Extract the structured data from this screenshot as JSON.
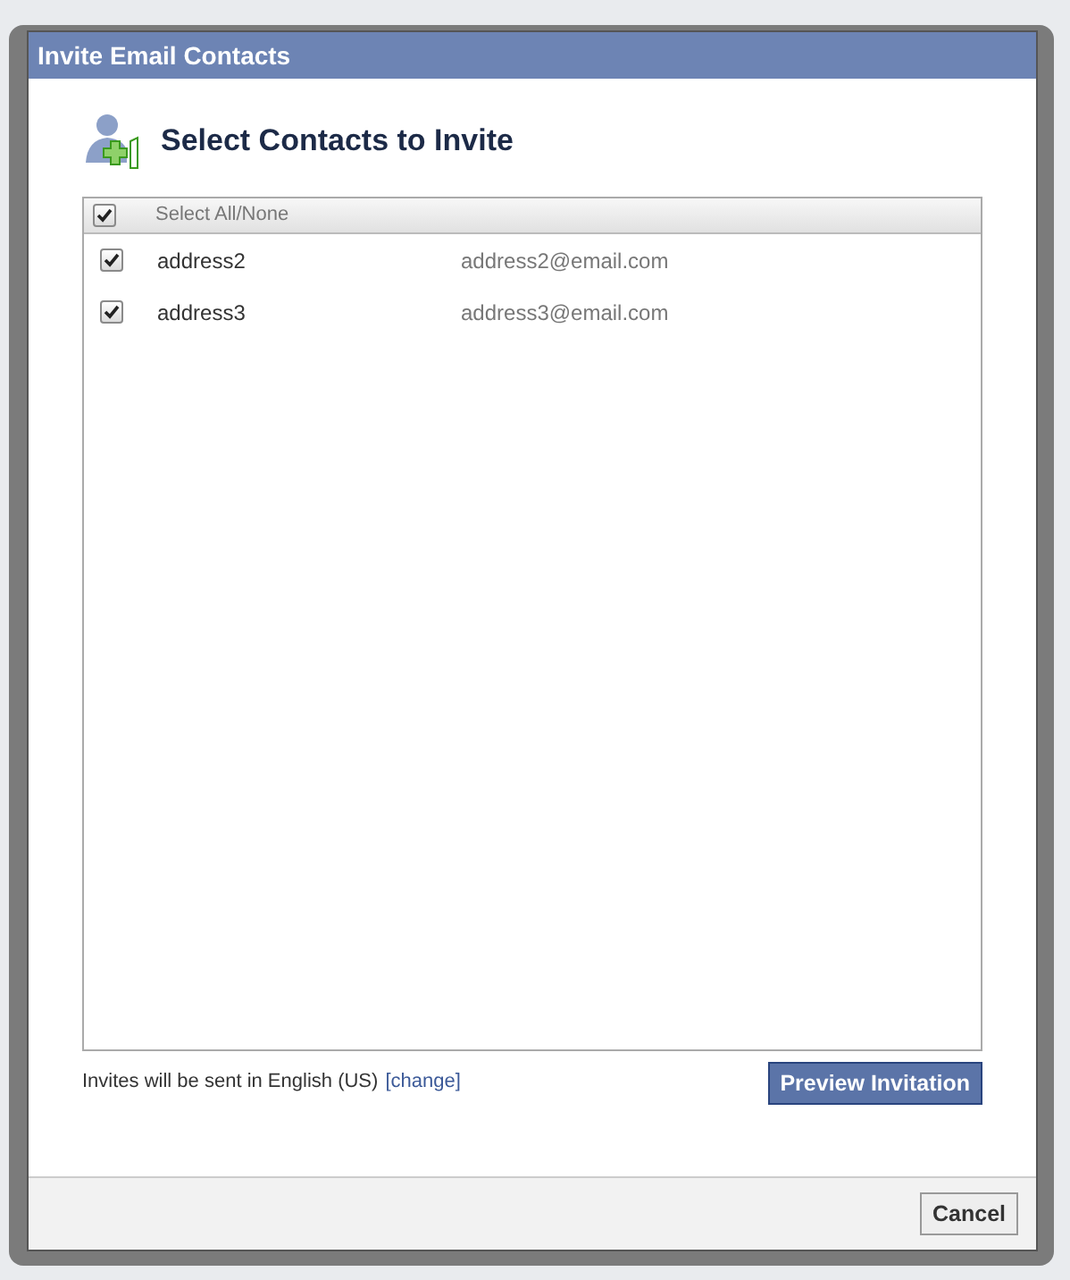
{
  "dialog": {
    "title": "Invite Email Contacts",
    "heading": "Select Contacts to Invite",
    "select_all": {
      "label": "Select All/None",
      "checked": true
    },
    "contacts": [
      {
        "name": "address2",
        "email": "address2@email.com",
        "checked": true
      },
      {
        "name": "address3",
        "email": "address3@email.com",
        "checked": true
      }
    ],
    "language_note": "Invites will be sent in English (US)",
    "change_link": "[change]",
    "primary_button": "Preview Invitation",
    "cancel_button": "Cancel"
  }
}
